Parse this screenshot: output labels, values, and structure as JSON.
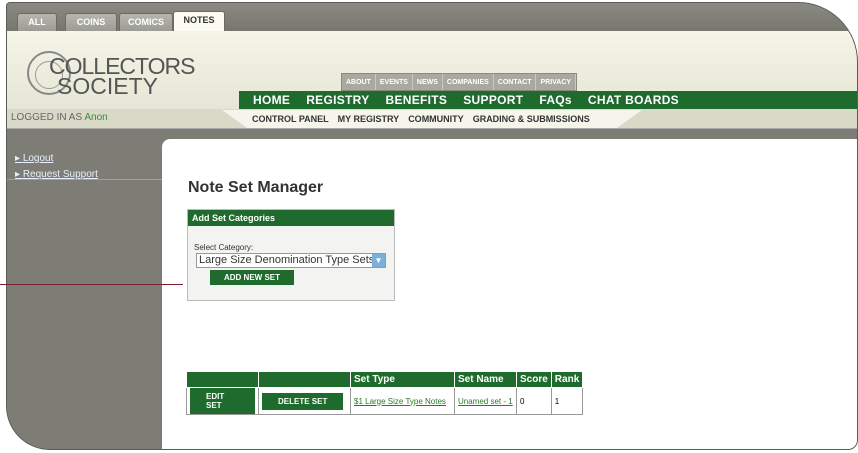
{
  "top_tabs": [
    "ALL",
    "COINS",
    "COMICS",
    "NOTES"
  ],
  "logo": {
    "line1": "COLLECTORS",
    "line2": "SOCIETY"
  },
  "small_nav": [
    "ABOUT",
    "EVENTS",
    "NEWS",
    "COMPANIES",
    "CONTACT",
    "PRIVACY"
  ],
  "main_nav": [
    "HOME",
    "REGISTRY",
    "BENEFITS",
    "SUPPORT",
    "FAQs",
    "CHAT BOARDS"
  ],
  "logged_in": {
    "label": "LOGGED IN AS",
    "user": "Anon"
  },
  "sub_nav": [
    "CONTROL PANEL",
    "MY REGISTRY",
    "COMMUNITY",
    "GRADING & SUBMISSIONS"
  ],
  "sidebar": {
    "logout": "Logout",
    "request_support": "Request Support"
  },
  "page_title": "Note Set Manager",
  "panel": {
    "title": "Add Set Categories",
    "select_label": "Select Category:",
    "select_value": "Large Size Denomination Type Sets",
    "add_button": "ADD NEW SET"
  },
  "table": {
    "headers": [
      "",
      "",
      "Set Type",
      "Set Name",
      "Score",
      "Rank"
    ],
    "rows": [
      {
        "edit": "EDIT SET",
        "delete": "DELETE SET",
        "set_type": "$1 Large Size Type Notes",
        "set_name": "Unamed set - 1",
        "score": "0",
        "rank": "1"
      }
    ]
  },
  "colors": {
    "brand_green": "#1e6b2d",
    "frame_gray": "#7d7d75",
    "header_bg": "#f5f5e8"
  }
}
